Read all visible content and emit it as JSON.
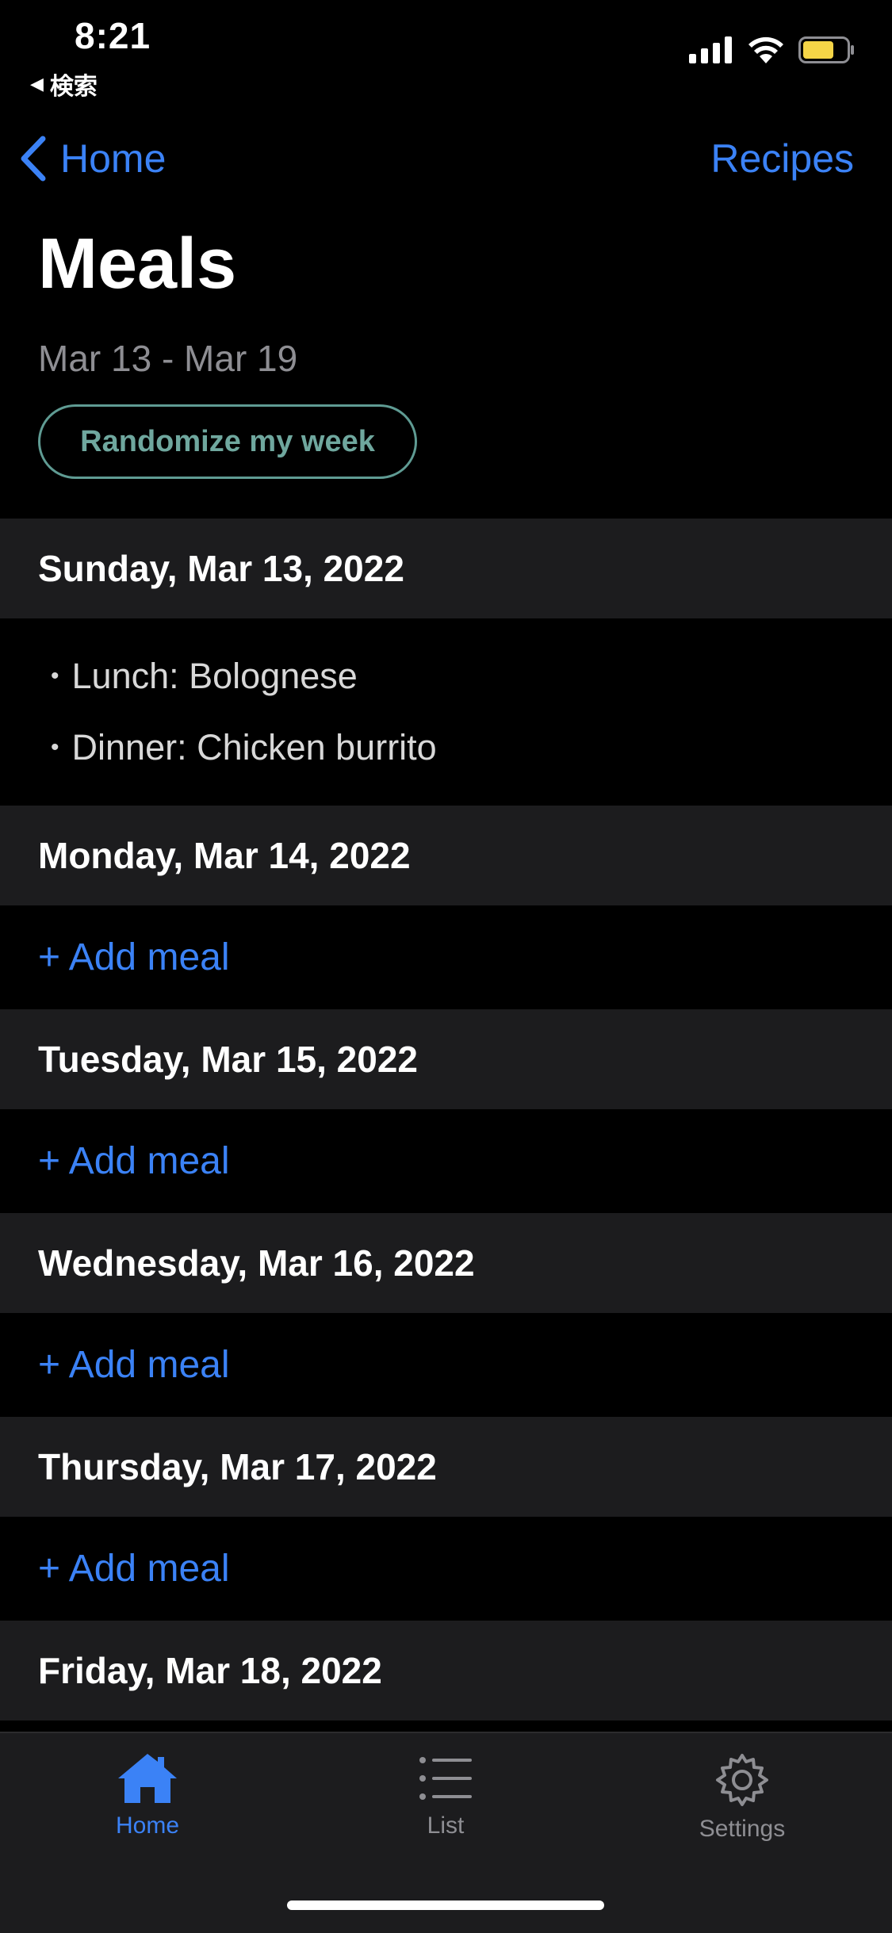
{
  "status_bar": {
    "time": "8:21",
    "back_app_label": "検索",
    "icons": [
      "signal-icon",
      "wifi-icon",
      "battery-icon"
    ],
    "battery_color": "#f5d547"
  },
  "nav": {
    "back_label": "Home",
    "right_label": "Recipes"
  },
  "header": {
    "title": "Meals",
    "date_range": "Mar 13 - Mar 19",
    "randomize_label": "Randomize my week"
  },
  "days": [
    {
      "label": "Sunday, Mar 13, 2022",
      "meals": [
        "Lunch: Bolognese",
        "Dinner: Chicken burrito"
      ]
    },
    {
      "label": "Monday, Mar 14, 2022",
      "add_label": "+ Add meal"
    },
    {
      "label": "Tuesday, Mar 15, 2022",
      "add_label": "+ Add meal"
    },
    {
      "label": "Wednesday, Mar 16, 2022",
      "add_label": "+ Add meal"
    },
    {
      "label": "Thursday, Mar 17, 2022",
      "add_label": "+ Add meal"
    },
    {
      "label": "Friday, Mar 18, 2022"
    }
  ],
  "tabs": [
    {
      "label": "Home",
      "icon": "house-icon",
      "active": true
    },
    {
      "label": "List",
      "icon": "list-icon",
      "active": false
    },
    {
      "label": "Settings",
      "icon": "gear-icon",
      "active": false
    }
  ],
  "colors": {
    "accent": "#3b82f6",
    "randomize": "#6fa79e",
    "header_bg": "#1c1c1e",
    "background": "#000000"
  }
}
